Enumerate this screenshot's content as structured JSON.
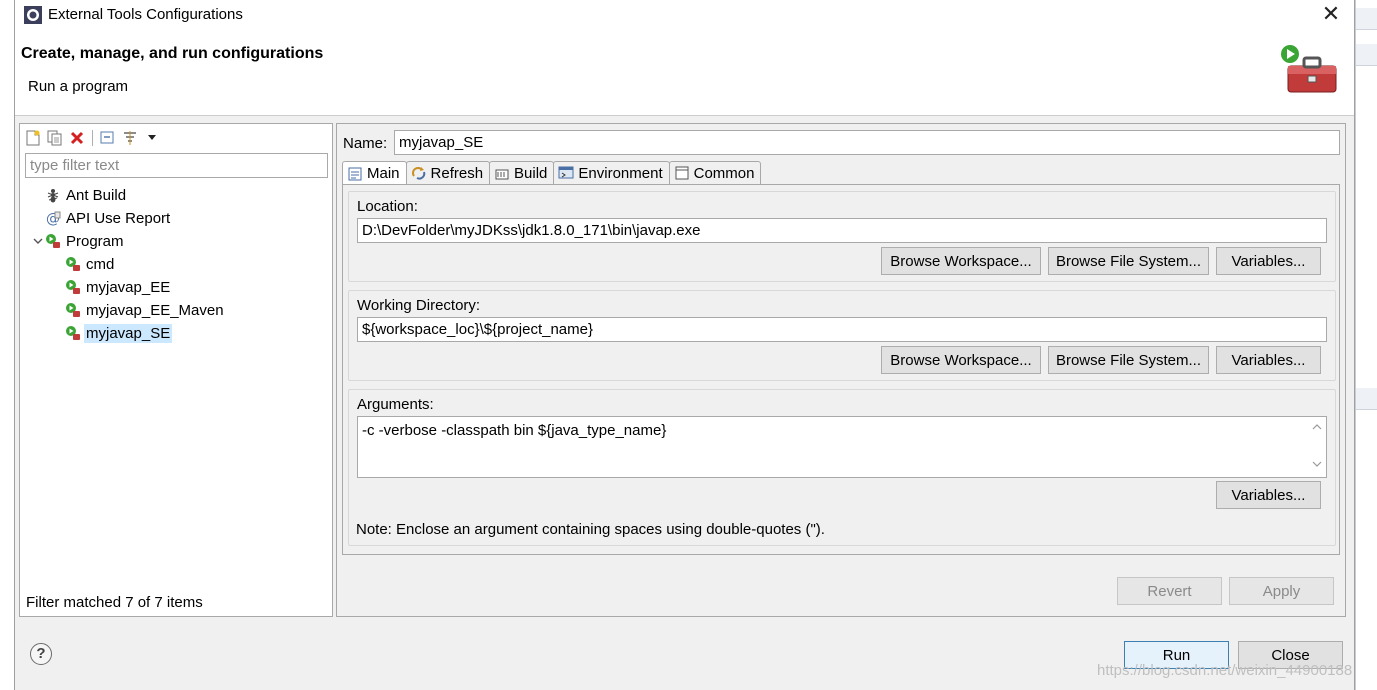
{
  "window": {
    "title": "External Tools Configurations",
    "close_glyph": "✕"
  },
  "banner": {
    "heading": "Create, manage, and run configurations",
    "subtitle": "Run a program"
  },
  "left": {
    "toolbar_icons": [
      "new-configuration-icon",
      "duplicate-icon",
      "delete-icon",
      "collapse-all-icon",
      "filter-icon",
      "dropdown-icon"
    ],
    "filter_placeholder": "type filter text",
    "tree": {
      "ant_build": "Ant Build",
      "api_use_report": "API Use Report",
      "program": "Program",
      "children": [
        "cmd",
        "myjavap_EE",
        "myjavap_EE_Maven",
        "myjavap_SE"
      ]
    },
    "status": "Filter matched 7 of 7 items"
  },
  "right": {
    "name_label": "Name:",
    "name_value": "myjavap_SE",
    "tabs": [
      "Main",
      "Refresh",
      "Build",
      "Environment",
      "Common"
    ],
    "location": {
      "label": "Location:",
      "value": "D:\\DevFolder\\myJDKss\\jdk1.8.0_171\\bin\\javap.exe"
    },
    "working_dir": {
      "label": "Working Directory:",
      "value": "${workspace_loc}\\${project_name}"
    },
    "arguments": {
      "label": "Arguments:",
      "value": "-c -verbose -classpath bin ${java_type_name}"
    },
    "buttons": {
      "browse_workspace": "Browse Workspace...",
      "browse_fs": "Browse File System...",
      "variables": "Variables..."
    },
    "note": "Note: Enclose an argument containing spaces using double-quotes (\").",
    "revert": "Revert",
    "apply": "Apply"
  },
  "footer": {
    "help": "?",
    "run": "Run",
    "close": "Close"
  },
  "watermark": "https://blog.csdn.net/weixin_44900188"
}
